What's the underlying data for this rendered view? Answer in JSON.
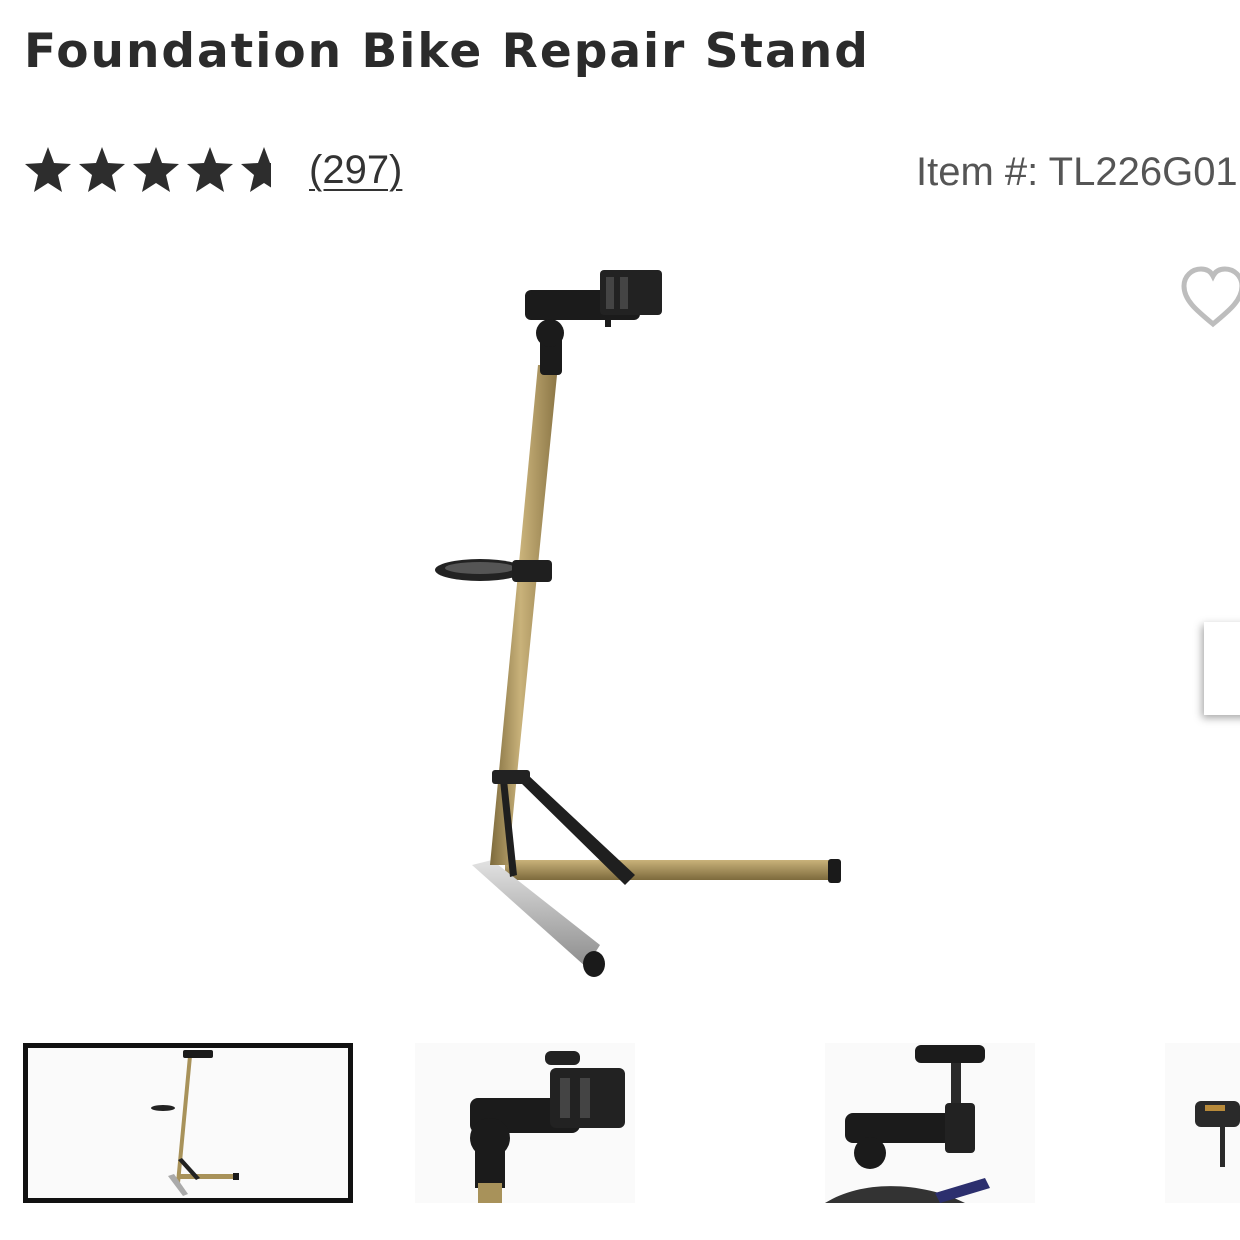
{
  "product": {
    "title": "Foundation Bike Repair Stand",
    "rating": 4.5,
    "rating_max": 5,
    "review_count_label": "(297)",
    "item_number_label": "Item #: TL226G01"
  },
  "colors": {
    "text": "#2b2b2b",
    "star": "#2d2d2d",
    "gold_tube": "#a8925a",
    "silver_tube": "#b9b9b9"
  },
  "icons": {
    "wishlist": "heart-outline-icon",
    "rating": "star-icon"
  },
  "gallery": {
    "selected_index": 0,
    "thumbnails": [
      {
        "name": "full-stand"
      },
      {
        "name": "clamp-head"
      },
      {
        "name": "clamp-on-seatpost"
      },
      {
        "name": "partial-view"
      }
    ]
  }
}
